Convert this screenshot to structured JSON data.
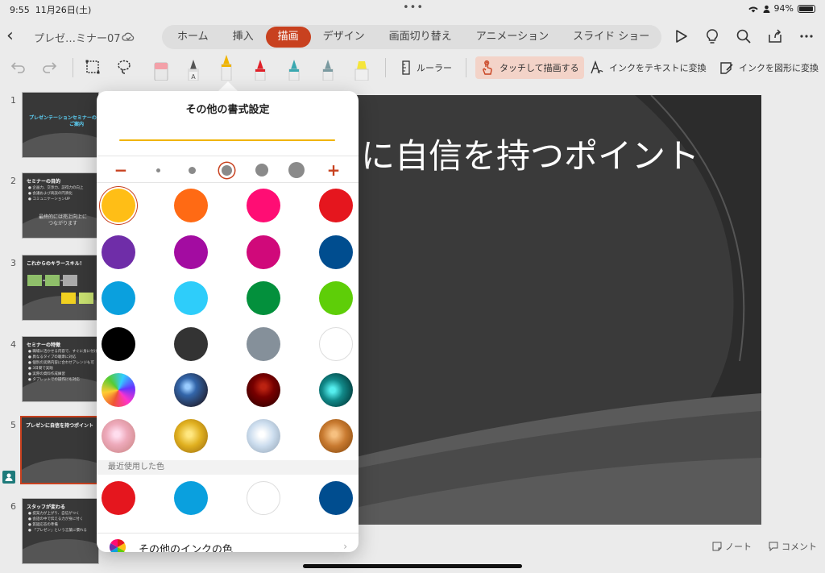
{
  "status": {
    "time": "9:55",
    "date": "11月26日(土)",
    "battery": "94%",
    "battery_level": 0.94
  },
  "topbar": {
    "doc_title": "プレゼ…ミナー07",
    "tabs": [
      {
        "label": "ホーム",
        "active": false
      },
      {
        "label": "挿入",
        "active": false
      },
      {
        "label": "描画",
        "active": true
      },
      {
        "label": "デザイン",
        "active": false
      },
      {
        "label": "画面切り替え",
        "active": false
      },
      {
        "label": "アニメーション",
        "active": false
      },
      {
        "label": "スライド ショー",
        "active": false
      }
    ]
  },
  "drawbar": {
    "ruler": "ルーラー",
    "touch_draw": "タッチして描画する",
    "ink_to_text": "インクをテキストに変換",
    "ink_to_shape": "インクを図形に変換",
    "pens": [
      "#f3a0a8",
      "#ffffff",
      "#f0b400",
      "#e02028",
      "#3aa8b0",
      "#7a9aa0",
      "#f5e53a"
    ]
  },
  "slides": [
    {
      "num": "1",
      "title": "プレゼンテーションセミナーの",
      "title2": "ご案内",
      "body": []
    },
    {
      "num": "2",
      "title": "セミナーの目的",
      "body": [
        "● 企画力、交渉力、説得力の向上",
        "● 会議および商談の円滑化",
        "● コミュニケーションUP",
        "最終的には売上向上に",
        "つながります"
      ]
    },
    {
      "num": "3",
      "title": "これからのキラースキル！",
      "body": []
    },
    {
      "num": "4",
      "title": "セミナーの特徴",
      "body": [
        "● 職場に活かせる内容で、すぐに身に付ける",
        "● 異なるタイプの聴衆に対応",
        "● 個別の実務内容に合わせアレンジも可",
        "● 3日間で実践",
        "● 実際の資料作成練習",
        "● タブレットでの操作にも対応"
      ]
    },
    {
      "num": "5",
      "title": "プレゼンに自信を持つポイント",
      "body": [],
      "selected": true
    },
    {
      "num": "6",
      "title": "スタッフが変わる",
      "body": [
        "● 提案力が上がり、自信がつく",
        "● 会話の中で伝える力が身に付く",
        "● 質疑応答の準備",
        "● 「プレゼン」という言葉に慣れる"
      ]
    }
  ],
  "slide": {
    "title": "に自信を持つポイント"
  },
  "bottom": {
    "notes": "ノート",
    "comments": "コメント"
  },
  "popover": {
    "title": "その他の書式設定",
    "preview_color": "#f0b400",
    "thickness_minus": "−",
    "thickness_plus": "+",
    "thickness_levels": [
      1,
      2,
      3,
      4,
      5
    ],
    "selected_thickness": 3,
    "colors": [
      [
        "#ffbe16",
        "#ff6a14",
        "#ff0d74",
        "#e5161e"
      ],
      [
        "#6f2da8",
        "#a30ca1",
        "#d0097a",
        "#004d8f"
      ],
      [
        "#0aa0de",
        "#2ecdfa",
        "#03903c",
        "#5ece08"
      ],
      [
        "#000000",
        "#333333",
        "#85909a",
        "#ffffff"
      ]
    ],
    "textures": [
      "rainbow-texture",
      "galaxy-texture",
      "lava-texture",
      "ocean-texture",
      "rose-gold-texture",
      "gold-texture",
      "silver-texture",
      "bronze-texture"
    ],
    "recent_header": "最近使用した色",
    "recent": [
      "#e5161e",
      "#0aa0de",
      "#ffffff",
      "#004d8f"
    ],
    "more_ink": "その他のインクの色"
  }
}
